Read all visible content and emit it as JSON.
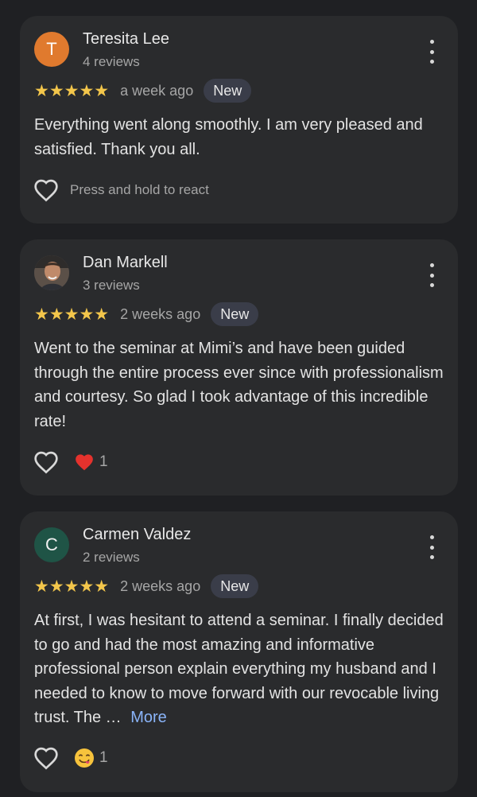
{
  "reviews": [
    {
      "initial": "T",
      "avatar_color": "#e07a2e",
      "name": "Teresita Lee",
      "review_count": "4 reviews",
      "stars": "★★★★★",
      "rating": 5,
      "time_ago": "a week ago",
      "badge": "New",
      "text": "Everything went along smoothly. I am very pleased and satisfied. Thank you all.",
      "react_hint": "Press and hold to react"
    },
    {
      "avatar": "profile-photo",
      "name": "Dan Markell",
      "review_count": "3 reviews",
      "stars": "★★★★★",
      "rating": 5,
      "time_ago": "2 weeks ago",
      "badge": "New",
      "text": "Went to the seminar at Mimi’s and have been guided through the entire process ever since with professionalism and courtesy. So glad I took advantage of this incredible rate!",
      "reaction_icon": "red-heart-icon",
      "reaction_count": "1"
    },
    {
      "initial": "C",
      "avatar_color": "#1f5446",
      "name": "Carmen Valdez",
      "review_count": "2 reviews",
      "stars": "★★★★★",
      "rating": 5,
      "time_ago": "2 weeks ago",
      "badge": "New",
      "text": "At first, I was hesitant to attend a seminar. I finally decided to go and had the most amazing and informative professional person explain everything my husband and I needed to know to move forward with our revocable living trust. The …",
      "more_label": "More",
      "reaction_icon": "face-savoring-food-icon",
      "reaction_count": "1"
    }
  ],
  "colors": {
    "background": "#1f2023",
    "card": "#2a2b2d",
    "star": "#f3c64b",
    "link": "#8ab4f8",
    "badge": "#3a3d49"
  }
}
